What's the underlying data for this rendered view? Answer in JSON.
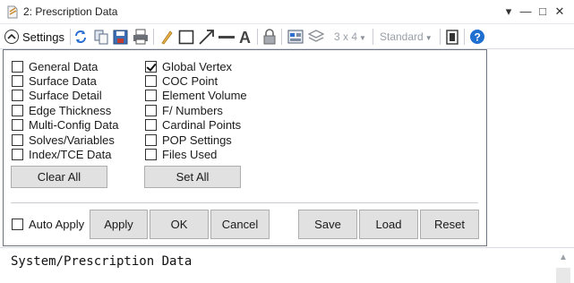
{
  "window": {
    "title": "2: Prescription Data",
    "controls": {
      "dropdown": "▾",
      "minimize": "—",
      "maximize": "□",
      "close": "✕"
    }
  },
  "toolbar": {
    "settings_label": "Settings",
    "layout_label": "3 x 4",
    "style_label": "Standard",
    "icons": [
      "settings-chevron-icon",
      "refresh-icon",
      "copy-icon",
      "save-icon",
      "print-icon",
      "pencil-icon",
      "rectangle-icon",
      "arrow-icon",
      "line-icon",
      "text-icon",
      "lock-icon",
      "tile-icon",
      "layers-icon",
      "window-icon",
      "help-icon"
    ]
  },
  "settings": {
    "left_column": [
      {
        "label": "General Data",
        "checked": false
      },
      {
        "label": "Surface Data",
        "checked": false
      },
      {
        "label": "Surface Detail",
        "checked": false
      },
      {
        "label": "Edge Thickness",
        "checked": false
      },
      {
        "label": "Multi-Config Data",
        "checked": false
      },
      {
        "label": "Solves/Variables",
        "checked": false
      },
      {
        "label": "Index/TCE Data",
        "checked": false
      }
    ],
    "right_column": [
      {
        "label": "Global Vertex",
        "checked": true
      },
      {
        "label": "COC Point",
        "checked": false
      },
      {
        "label": "Element Volume",
        "checked": false
      },
      {
        "label": "F/ Numbers",
        "checked": false
      },
      {
        "label": "Cardinal Points",
        "checked": false
      },
      {
        "label": "POP Settings",
        "checked": false
      },
      {
        "label": "Files Used",
        "checked": false
      }
    ],
    "clear_all_label": "Clear All",
    "set_all_label": "Set All",
    "auto_apply": {
      "label": "Auto Apply",
      "checked": false
    },
    "apply_label": "Apply",
    "ok_label": "OK",
    "cancel_label": "Cancel",
    "save_label": "Save",
    "load_label": "Load",
    "reset_label": "Reset"
  },
  "output": {
    "text": "System/Prescription Data"
  },
  "colors": {
    "accent_blue": "#1f6fd1",
    "button_face": "#e1e1e1",
    "panel_border": "#6f7580"
  }
}
